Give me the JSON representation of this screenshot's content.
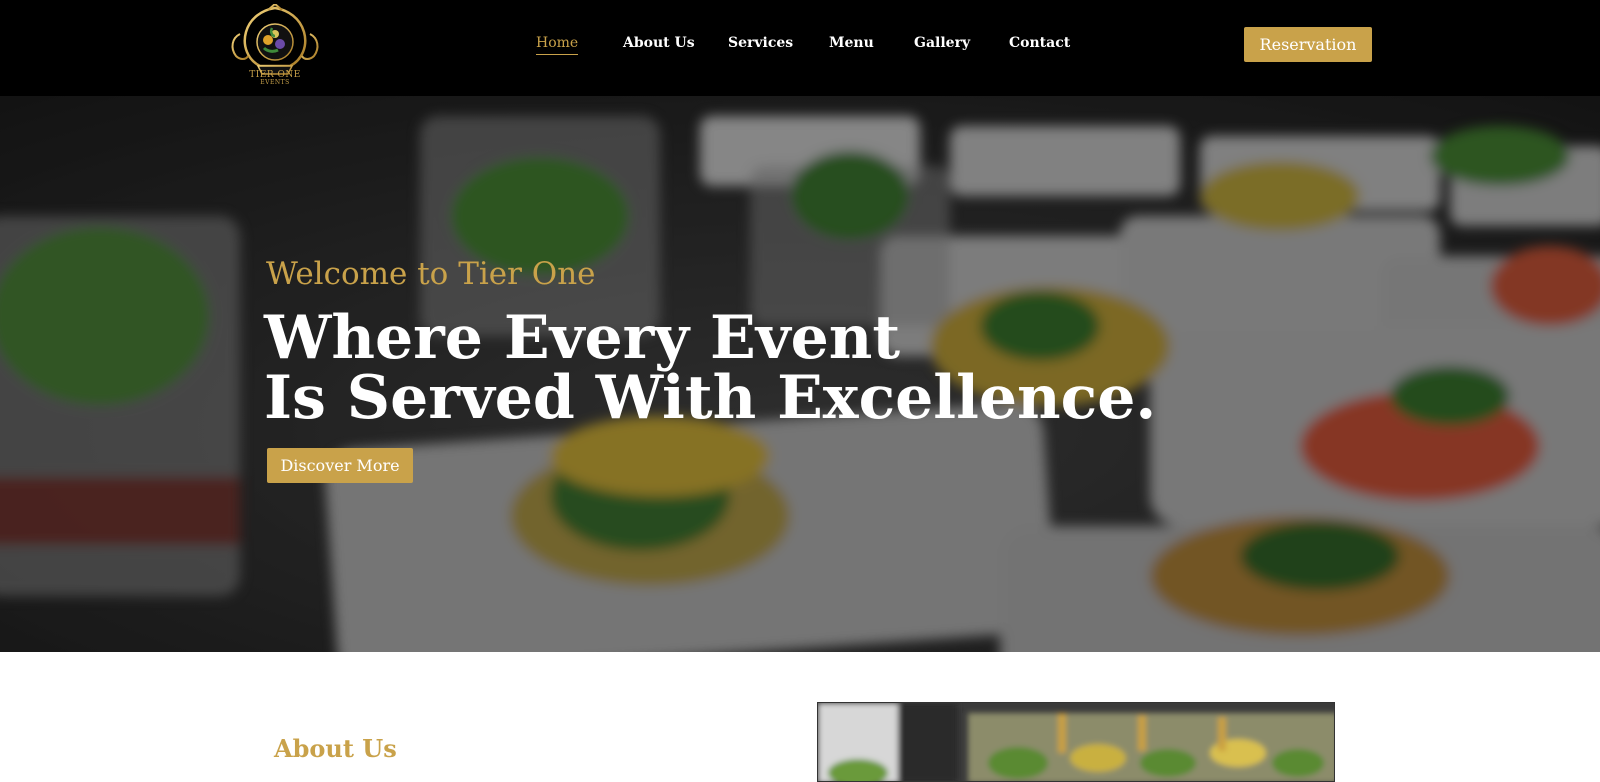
{
  "brand": {
    "logo_text": "TIER ONE",
    "logo_subtext": "EVENTS",
    "accent": "#c9a24a"
  },
  "nav": {
    "items": [
      {
        "label": "Home",
        "active": true
      },
      {
        "label": "About Us",
        "active": false
      },
      {
        "label": "Services",
        "active": false
      },
      {
        "label": "Menu",
        "active": false
      },
      {
        "label": "Gallery",
        "active": false
      },
      {
        "label": "Contact",
        "active": false
      }
    ],
    "reservation_label": "Reservation"
  },
  "hero": {
    "eyebrow": "Welcome to Tier One",
    "title_line1": "Where Every Event",
    "title_line2": "Is Served With Excellence.",
    "cta_label": "Discover More"
  },
  "about": {
    "heading": "About Us"
  },
  "colors": {
    "header_bg": "#000000",
    "accent_gold": "#c9a24a",
    "text_white": "#ffffff"
  }
}
